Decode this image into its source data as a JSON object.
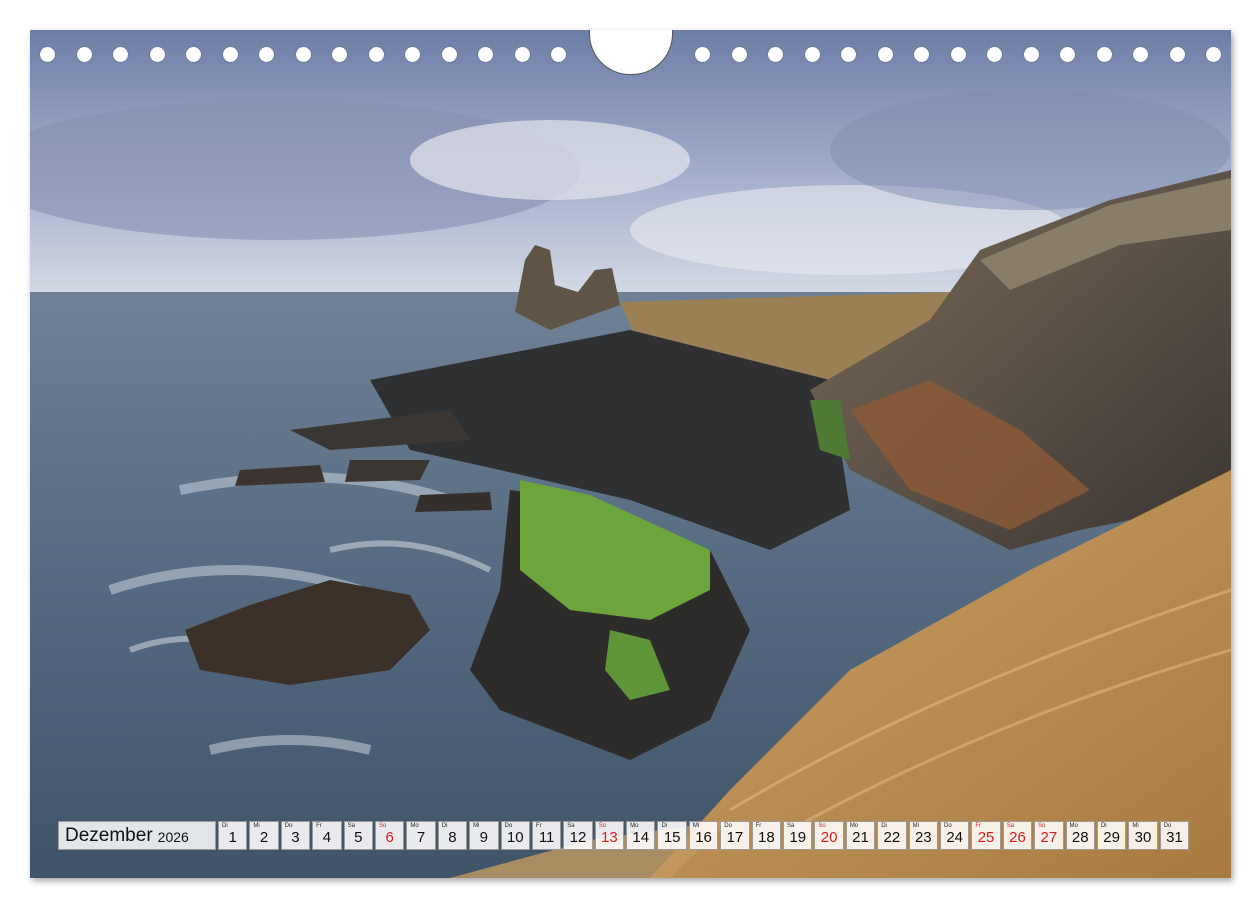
{
  "calendar": {
    "month": "Dezember",
    "year": "2026",
    "days": [
      {
        "wd": "Di",
        "num": "1",
        "red": false
      },
      {
        "wd": "Mi",
        "num": "2",
        "red": false
      },
      {
        "wd": "Do",
        "num": "3",
        "red": false
      },
      {
        "wd": "Fr",
        "num": "4",
        "red": false
      },
      {
        "wd": "Sa",
        "num": "5",
        "red": false
      },
      {
        "wd": "So",
        "num": "6",
        "red": true
      },
      {
        "wd": "Mo",
        "num": "7",
        "red": false
      },
      {
        "wd": "Di",
        "num": "8",
        "red": false
      },
      {
        "wd": "Mi",
        "num": "9",
        "red": false
      },
      {
        "wd": "Do",
        "num": "10",
        "red": false
      },
      {
        "wd": "Fr",
        "num": "11",
        "red": false
      },
      {
        "wd": "Sa",
        "num": "12",
        "red": false
      },
      {
        "wd": "So",
        "num": "13",
        "red": true
      },
      {
        "wd": "Mo",
        "num": "14",
        "red": false
      },
      {
        "wd": "Di",
        "num": "15",
        "red": false
      },
      {
        "wd": "Mi",
        "num": "16",
        "red": false
      },
      {
        "wd": "Do",
        "num": "17",
        "red": false
      },
      {
        "wd": "Fr",
        "num": "18",
        "red": false
      },
      {
        "wd": "Sa",
        "num": "19",
        "red": false
      },
      {
        "wd": "So",
        "num": "20",
        "red": true
      },
      {
        "wd": "Mo",
        "num": "21",
        "red": false
      },
      {
        "wd": "Di",
        "num": "22",
        "red": false
      },
      {
        "wd": "Mi",
        "num": "23",
        "red": false
      },
      {
        "wd": "Do",
        "num": "24",
        "red": false
      },
      {
        "wd": "Fr",
        "num": "25",
        "red": true
      },
      {
        "wd": "Sa",
        "num": "26",
        "red": true
      },
      {
        "wd": "So",
        "num": "27",
        "red": true
      },
      {
        "wd": "Mo",
        "num": "28",
        "red": false
      },
      {
        "wd": "Di",
        "num": "29",
        "red": false
      },
      {
        "wd": "Mi",
        "num": "30",
        "red": false
      },
      {
        "wd": "Do",
        "num": "31",
        "red": false
      }
    ]
  },
  "colors": {
    "holiday_red": "#d81e1e"
  }
}
